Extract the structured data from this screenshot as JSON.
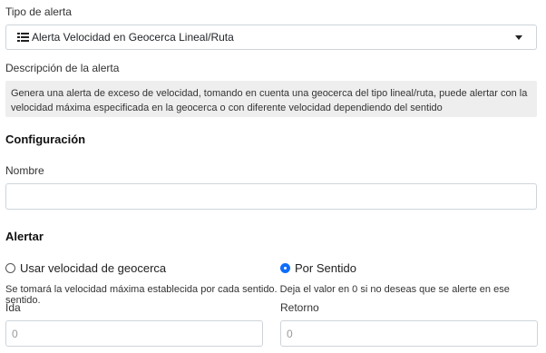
{
  "alert_type": {
    "label": "Tipo de alerta",
    "selected": "Alerta Velocidad en Geocerca Lineal/Ruta"
  },
  "description": {
    "label": "Descripción de la alerta",
    "line1": "Genera una alerta de exceso de velocidad, tomando en cuenta una geocerca del tipo lineal/ruta, puede alertar con la",
    "line2": "velocidad máxima especificada en la geocerca o con diferente velocidad dependiendo del sentido"
  },
  "config": {
    "title": "Configuración",
    "name_label": "Nombre",
    "name_value": ""
  },
  "alert": {
    "title": "Alertar",
    "option_geofence": "Usar velocidad de geocerca",
    "option_direction": "Por Sentido",
    "selected": "Por Sentido",
    "hint": "Se tomará la velocidad máxima establecida por cada sentido. Deja el valor en 0 si no deseas que se alerte en ese sentido.",
    "ida_label": "Ida",
    "ida_value": "0",
    "retorno_label": "Retorno",
    "retorno_value": "0"
  },
  "colors": {
    "accent": "#0d6efd",
    "desc_bg": "#eeeeee",
    "border": "#ced4da"
  }
}
